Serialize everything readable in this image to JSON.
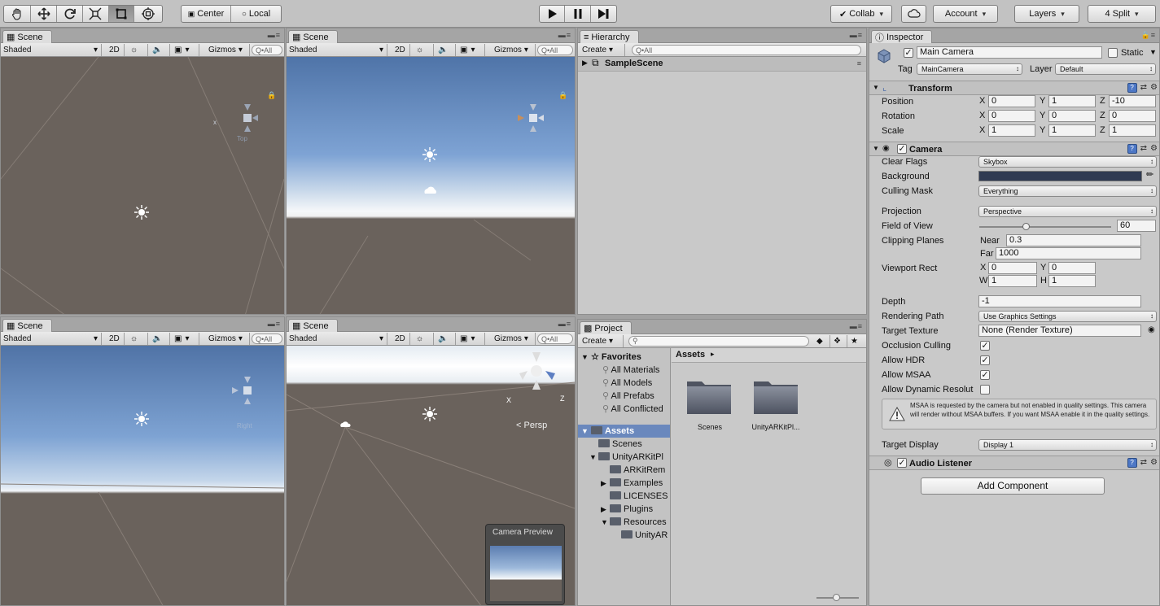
{
  "toolbar": {
    "pivot_center": "Center",
    "pivot_local": "Local",
    "collab": "Collab",
    "account": "Account",
    "layers": "Layers",
    "layout": "4 Split"
  },
  "scene_views": [
    {
      "tab": "Scene",
      "shading": "Shaded",
      "mode2d": "2D",
      "gizmos": "Gizmos",
      "search_placeholder": "Q•All",
      "axis_label": "Top"
    },
    {
      "tab": "Scene",
      "shading": "Shaded",
      "mode2d": "2D",
      "gizmos": "Gizmos",
      "search_placeholder": "Q•All"
    },
    {
      "tab": "Scene",
      "shading": "Shaded",
      "mode2d": "2D",
      "gizmos": "Gizmos",
      "search_placeholder": "Q•All",
      "axis_label": "Right"
    },
    {
      "tab": "Scene",
      "shading": "Shaded",
      "mode2d": "2D",
      "gizmos": "Gizmos",
      "search_placeholder": "Q•All",
      "axis_label": "Persp",
      "camera_preview_title": "Camera Preview"
    }
  ],
  "hierarchy": {
    "tab": "Hierarchy",
    "create": "Create",
    "search_placeholder": "Q•All",
    "scene_name": "SampleScene"
  },
  "project": {
    "tab": "Project",
    "create": "Create",
    "favorites_label": "Favorites",
    "favorites": [
      "All Materials",
      "All Models",
      "All Prefabs",
      "All Conflicted"
    ],
    "assets_root": "Assets",
    "tree": [
      {
        "label": "Scenes",
        "indent": 1,
        "arrow": ""
      },
      {
        "label": "UnityARKitPl",
        "indent": 1,
        "arrow": "down"
      },
      {
        "label": "ARKitRem",
        "indent": 2,
        "arrow": ""
      },
      {
        "label": "Examples",
        "indent": 2,
        "arrow": "right"
      },
      {
        "label": "LICENSES",
        "indent": 2,
        "arrow": ""
      },
      {
        "label": "Plugins",
        "indent": 2,
        "arrow": "right"
      },
      {
        "label": "Resources",
        "indent": 2,
        "arrow": "down"
      },
      {
        "label": "UnityAR",
        "indent": 3,
        "arrow": ""
      }
    ],
    "breadcrumb": "Assets",
    "assets": [
      "Scenes",
      "UnityARKitPl..."
    ]
  },
  "inspector": {
    "tab": "Inspector",
    "object_name": "Main Camera",
    "static_label": "Static",
    "tag_label": "Tag",
    "tag_value": "MainCamera",
    "layer_label": "Layer",
    "layer_value": "Default",
    "transform": {
      "title": "Transform",
      "position_label": "Position",
      "position": [
        "0",
        "1",
        "-10"
      ],
      "rotation_label": "Rotation",
      "rotation": [
        "0",
        "0",
        "0"
      ],
      "scale_label": "Scale",
      "scale": [
        "1",
        "1",
        "1"
      ]
    },
    "camera": {
      "title": "Camera",
      "clear_flags_label": "Clear Flags",
      "clear_flags": "Skybox",
      "background_label": "Background",
      "background_color": "#2f3a52",
      "culling_mask_label": "Culling Mask",
      "culling_mask": "Everything",
      "projection_label": "Projection",
      "projection": "Perspective",
      "fov_label": "Field of View",
      "fov": "60",
      "fov_fraction": 0.33,
      "clipping_label": "Clipping Planes",
      "near_label": "Near",
      "near": "0.3",
      "far_label": "Far",
      "far": "1000",
      "viewport_label": "Viewport Rect",
      "viewport": {
        "x": "0",
        "y": "0",
        "w": "1",
        "h": "1"
      },
      "depth_label": "Depth",
      "depth": "-1",
      "rendering_path_label": "Rendering Path",
      "rendering_path": "Use Graphics Settings",
      "target_texture_label": "Target Texture",
      "target_texture": "None (Render Texture)",
      "occlusion_label": "Occlusion Culling",
      "hdr_label": "Allow HDR",
      "msaa_label": "Allow MSAA",
      "dynres_label": "Allow Dynamic Resolut",
      "warning": "MSAA is requested by the camera but not enabled in quality settings. This camera will render without MSAA buffers. If you want MSAA enable it in the quality settings.",
      "target_display_label": "Target Display",
      "target_display": "Display 1"
    },
    "audio_listener": "Audio Listener",
    "add_component": "Add Component"
  },
  "colors": {
    "ground": "#6a625c",
    "sky_top": "#5476a8",
    "editor_bg": "#c9c9c9",
    "toolbar_bg": "#c2c2c2"
  }
}
